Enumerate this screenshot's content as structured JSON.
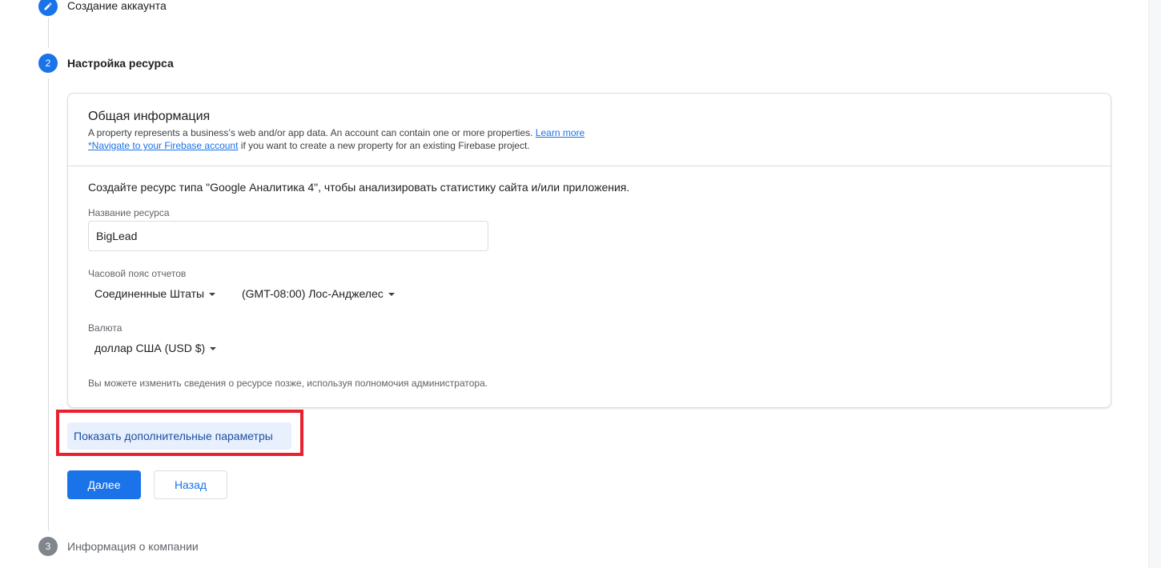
{
  "steps": [
    {
      "number": "",
      "label": "Создание аккаунта",
      "state": "done",
      "icon": "pencil-icon"
    },
    {
      "number": "2",
      "label": "Настройка ресурса",
      "state": "active"
    },
    {
      "number": "3",
      "label": "Информация о компании",
      "state": "pending"
    }
  ],
  "card": {
    "title": "Общая информация",
    "desc_line1": "A property represents a business’s web and/or app data. An account can contain one or more properties.",
    "learn_more": "Learn more",
    "firebase_link": "*Navigate to your Firebase account",
    "desc_line2_rest": " if you want to create a new property for an existing Firebase project.",
    "intro": "Создайте ресурс типа \"Google Аналитика 4\", чтобы анализировать статистику сайта и/или приложения.",
    "name_label": "Название ресурса",
    "name_value": "BigLead",
    "timezone_label": "Часовой пояс отчетов",
    "country": "Соединенные Штаты",
    "timezone": "(GMT-08:00) Лос-Анджелес",
    "currency_label": "Валюта",
    "currency": "доллар США (USD $)",
    "note": "Вы можете изменить сведения о ресурсе позже, используя полномочия администратора."
  },
  "actions": {
    "advanced": "Показать дополнительные параметры",
    "next": "Далее",
    "back": "Назад"
  },
  "colors": {
    "accent": "#1a73e8",
    "highlight": "#e8202f",
    "pending_step": "#80868b"
  }
}
